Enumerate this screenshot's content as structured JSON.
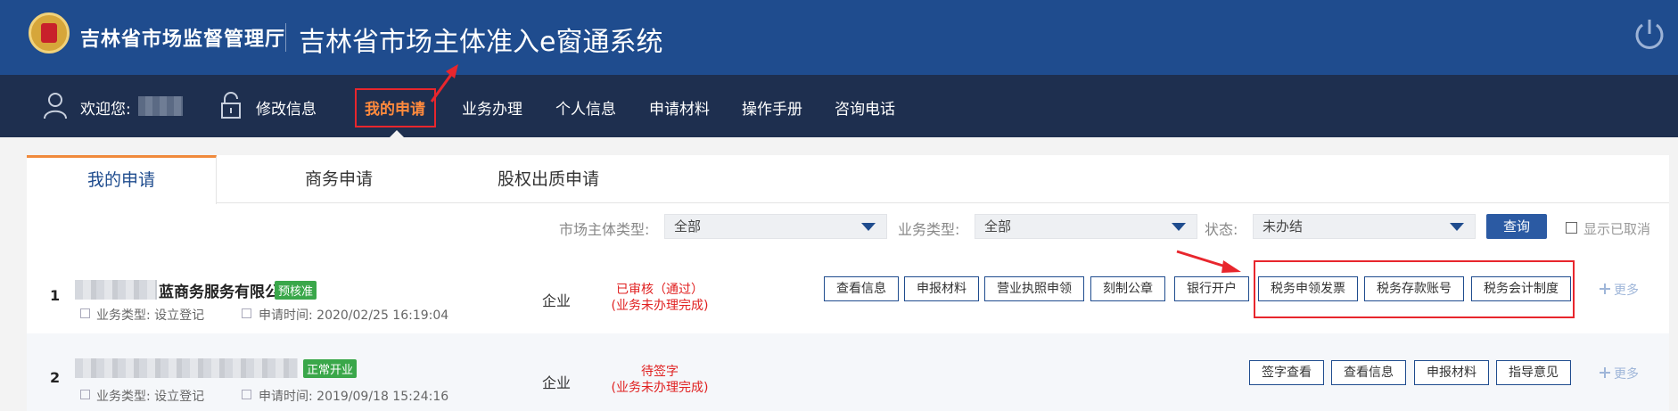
{
  "header": {
    "org_name": "吉林省市场监督管理厅",
    "system_name": "吉林省市场主体准入e窗通系统"
  },
  "nav": {
    "welcome": "欢迎您:",
    "items": [
      "修改信息",
      "我的申请",
      "业务办理",
      "个人信息",
      "申请材料",
      "操作手册",
      "咨询电话"
    ],
    "active": "我的申请"
  },
  "tabs": [
    "我的申请",
    "商务申请",
    "股权出质申请"
  ],
  "filters": {
    "entity_type_label": "市场主体类型:",
    "entity_type_value": "全部",
    "business_type_label": "业务类型:",
    "business_type_value": "全部",
    "status_label": "状态:",
    "status_value": "未办结",
    "query_button": "查询",
    "show_cancelled": "显示已取消"
  },
  "rows": [
    {
      "num": "1",
      "company_suffix": "蓝商务服务有限公司",
      "badge": "预核准",
      "business_type": "业务类型: 设立登记",
      "apply_time": "申请时间: 2020/02/25 16:19:04",
      "org_type": "企业",
      "status_line1": "已审核（通过）",
      "status_line2": "(业务未办理完成)",
      "actions": [
        "查看信息",
        "申报材料",
        "营业执照申领",
        "刻制公章",
        "银行开户",
        "税务申领发票",
        "税务存款账号",
        "税务会计制度"
      ],
      "more": "更多"
    },
    {
      "num": "2",
      "badge": "正常开业",
      "business_type": "业务类型: 设立登记",
      "apply_time": "申请时间: 2019/09/18 15:24:16",
      "org_type": "企业",
      "status_line1": "待签字",
      "status_line2": "(业务未办理完成)",
      "actions": [
        "签字查看",
        "查看信息",
        "申报材料",
        "指导意见"
      ],
      "more": "更多"
    }
  ],
  "colors": {
    "header_bg": "#1f4c8e",
    "nav_bg": "#1e2f4f",
    "active_nav": "#ff8a3d",
    "highlight": "#e8262d",
    "status_red": "#e02020"
  }
}
